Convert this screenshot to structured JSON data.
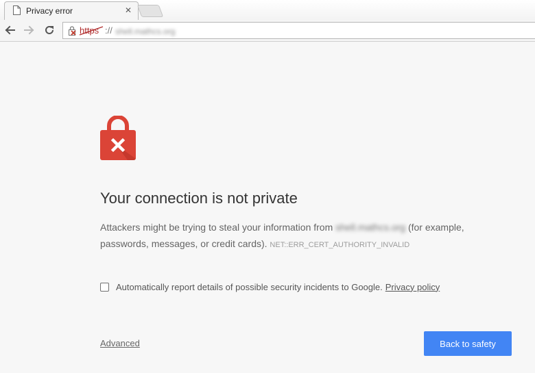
{
  "browser": {
    "tab": {
      "title": "Privacy error",
      "close_glyph": "✕",
      "icon": "page-icon"
    },
    "toolbar": {
      "back_icon": "back-arrow-icon",
      "forward_icon": "forward-arrow-icon",
      "reload_icon": "reload-icon"
    },
    "omnibox": {
      "security_icon": "insecure-lock-icon",
      "scheme": "https",
      "separator": "://",
      "host_blurred": "shell.mathcs.org"
    }
  },
  "interstitial": {
    "lock_icon": "red-lock-x-icon",
    "heading": "Your connection is not private",
    "body_before": "Attackers might be trying to steal your information from",
    "body_host_blurred": "shell.mathcs.org",
    "body_after": "(for example, passwords, messages, or credit cards).",
    "error_code": "NET::ERR_CERT_AUTHORITY_INVALID",
    "report_text": "Automatically report details of possible security incidents to Google.",
    "report_checked": false,
    "privacy_link": "Privacy policy",
    "advanced_link": "Advanced",
    "safety_button": "Back to safety"
  },
  "colors": {
    "accent_button": "#4285f4",
    "lock_red": "#db4437",
    "page_background": "#f7f7f7",
    "insecure_scheme": "#b02d2d"
  }
}
